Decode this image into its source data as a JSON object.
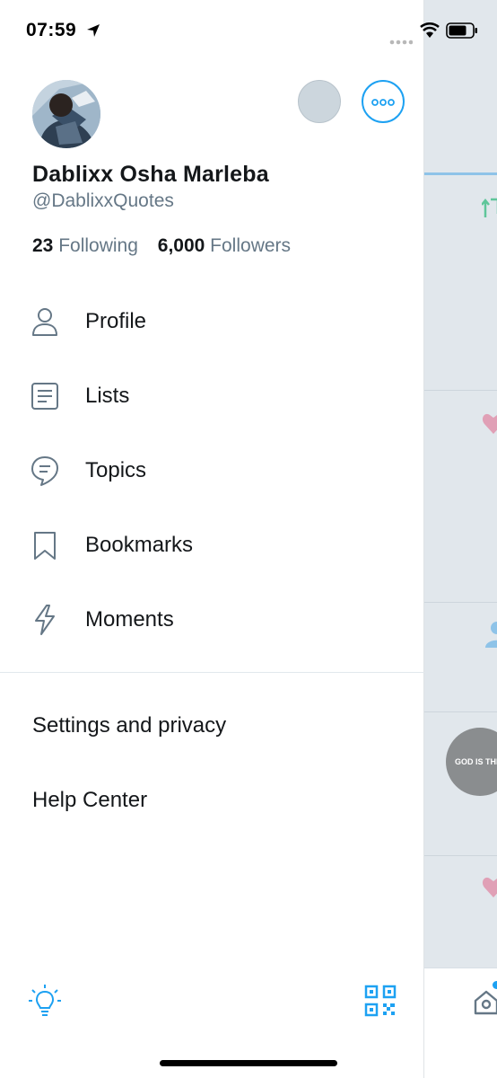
{
  "status_bar": {
    "time": "07:59",
    "icons": [
      "location-arrow-icon",
      "signal-icon",
      "wifi-icon",
      "battery-icon"
    ]
  },
  "profile": {
    "display_name": "Dablixx Osha Marleba",
    "handle": "@DablixxQuotes",
    "following_count": "23",
    "following_label": "Following",
    "followers_count": "6,000",
    "followers_label": "Followers"
  },
  "menu": {
    "items": [
      {
        "label": "Profile",
        "icon": "person-icon"
      },
      {
        "label": "Lists",
        "icon": "list-icon"
      },
      {
        "label": "Topics",
        "icon": "topics-icon"
      },
      {
        "label": "Bookmarks",
        "icon": "bookmark-icon"
      },
      {
        "label": "Moments",
        "icon": "lightning-icon"
      }
    ],
    "secondary": [
      {
        "label": "Settings and privacy"
      },
      {
        "label": "Help Center"
      }
    ]
  },
  "footer": {
    "left_icon": "lightbulb-icon",
    "right_icon": "qr-code-icon"
  },
  "background_timeline": {
    "avatar_text": "GOD IS THE PL"
  },
  "colors": {
    "accent": "#1da1f2",
    "text_primary": "#14171a",
    "text_secondary": "#657786",
    "icon_gray": "#657786",
    "overlay_bg": "#e1e7ec"
  }
}
